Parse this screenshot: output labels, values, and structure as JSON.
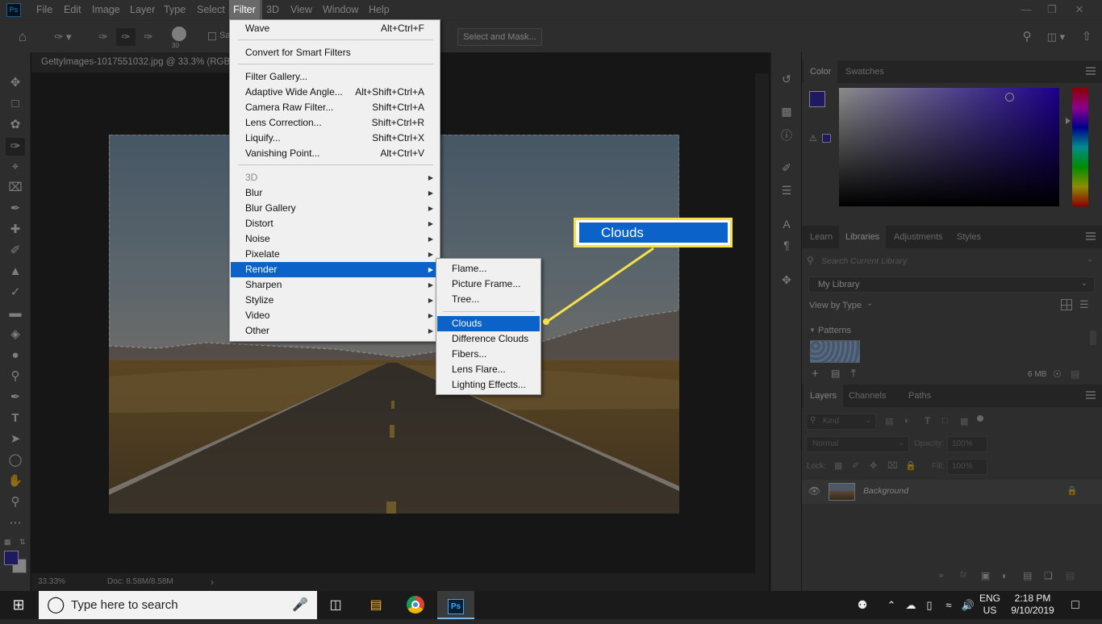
{
  "app": {
    "logo": "Ps"
  },
  "menubar": [
    "File",
    "Edit",
    "Image",
    "Layer",
    "Type",
    "Select",
    "Filter",
    "3D",
    "View",
    "Window",
    "Help"
  ],
  "options": {
    "brush_size": "30",
    "sample_label": "Sa",
    "select_mask": "Select and Mask..."
  },
  "document": {
    "tab_title": "GettyImages-1017551032.jpg @ 33.3% (RGB/",
    "zoom": "33.33%",
    "doc_info": "Doc: 8.58M/8.58M",
    "status_arrow": "›"
  },
  "filter_menu": {
    "last_filter": {
      "label": "Wave",
      "shortcut": "Alt+Ctrl+F"
    },
    "convert": "Convert for Smart Filters",
    "items_group": [
      {
        "label": "Filter Gallery...",
        "shortcut": ""
      },
      {
        "label": "Adaptive Wide Angle...",
        "shortcut": "Alt+Shift+Ctrl+A"
      },
      {
        "label": "Camera Raw Filter...",
        "shortcut": "Shift+Ctrl+A"
      },
      {
        "label": "Lens Correction...",
        "shortcut": "Shift+Ctrl+R"
      },
      {
        "label": "Liquify...",
        "shortcut": "Shift+Ctrl+X"
      },
      {
        "label": "Vanishing Point...",
        "shortcut": "Alt+Ctrl+V"
      }
    ],
    "submenus": [
      "3D",
      "Blur",
      "Blur Gallery",
      "Distort",
      "Noise",
      "Pixelate",
      "Render",
      "Sharpen",
      "Stylize",
      "Video",
      "Other"
    ]
  },
  "render_menu": {
    "group1": [
      "Flame...",
      "Picture Frame...",
      "Tree..."
    ],
    "group2": [
      "Clouds",
      "Difference Clouds",
      "Fibers...",
      "Lens Flare...",
      "Lighting Effects..."
    ]
  },
  "callout": {
    "text": "Clouds",
    "border_color": "#f4e04d"
  },
  "color_panel": {
    "tabs": [
      "Color",
      "Swatches"
    ],
    "foreground": "#3a2fb0",
    "hue": "#3300ff"
  },
  "libraries_panel": {
    "tabs": [
      "Learn",
      "Libraries",
      "Adjustments",
      "Styles"
    ],
    "search_placeholder": "Search Current Library",
    "library": "My Library",
    "view_by": "View by Type",
    "section": "Patterns",
    "size": "6 MB"
  },
  "layers_panel": {
    "tabs": [
      "Layers",
      "Channels",
      "Paths"
    ],
    "kind": "Kind",
    "blend": "Normal",
    "opacity_label": "Opacity:",
    "opacity": "100%",
    "lock_label": "Lock:",
    "fill_label": "Fill:",
    "fill": "100%",
    "layer_name": "Background"
  },
  "taskbar": {
    "search_placeholder": "Type here to search",
    "lang1": "ENG",
    "lang2": "US",
    "time": "2:18 PM",
    "date": "9/10/2019"
  }
}
